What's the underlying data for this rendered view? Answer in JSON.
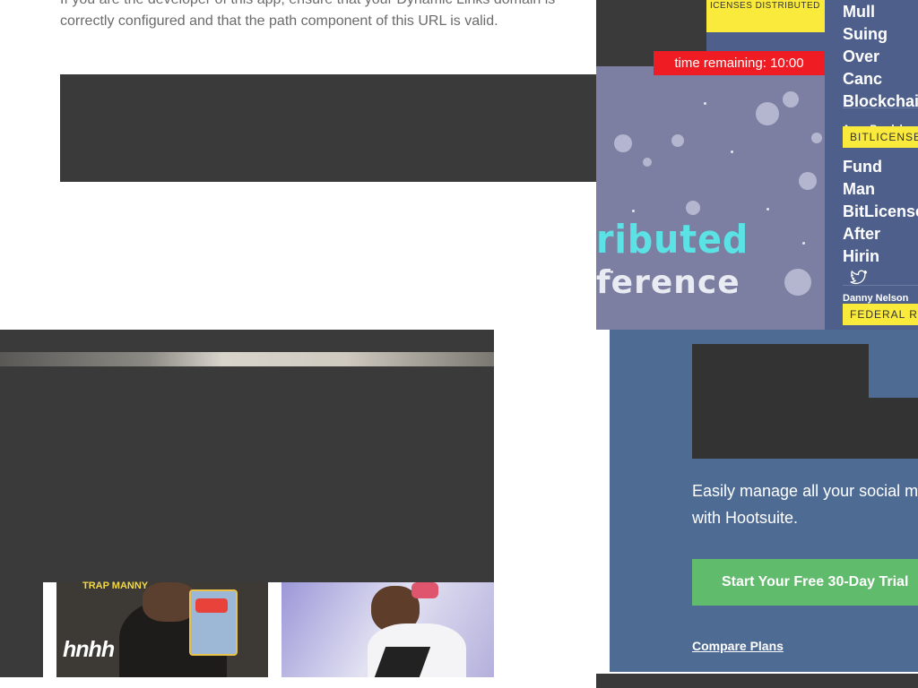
{
  "error": {
    "text": "If you are the developer of this app, ensure that your Dynamic Links domain is correctly configured and that the path component of this URL is valid."
  },
  "coindesk": {
    "promo": {
      "timer": "time remaining: 10:00",
      "title_fragment": "ributed",
      "subtitle_fragment": "ference",
      "top_tag": "ICENSES DISTRIBUTED"
    },
    "articles": [
      {
        "title": "Mull Suing Over Canc Blockchai",
        "author": "Anna Baydakov"
      },
      {
        "tag": "BITLICENSE",
        "title": "Fund Man BitLicense After Hirin",
        "author": "Danny Nelson"
      },
      {
        "tag": "FEDERAL R"
      }
    ]
  },
  "hootsuite": {
    "body": "Easily manage all your social m with Hootsuite.",
    "cta": "Start Your Free 30-Day Trial",
    "link": "Compare Plans"
  },
  "video": {
    "thumb1_caption": "TRAP MANNY",
    "logo": "hnhh"
  },
  "colors": {
    "coindesk_bg": "#4d5f8a",
    "tag_yellow": "#f9ea3b",
    "timer_red": "#ef1c24",
    "hootsuite_bg": "#4e6b94",
    "cta_green": "#61bb6c"
  }
}
